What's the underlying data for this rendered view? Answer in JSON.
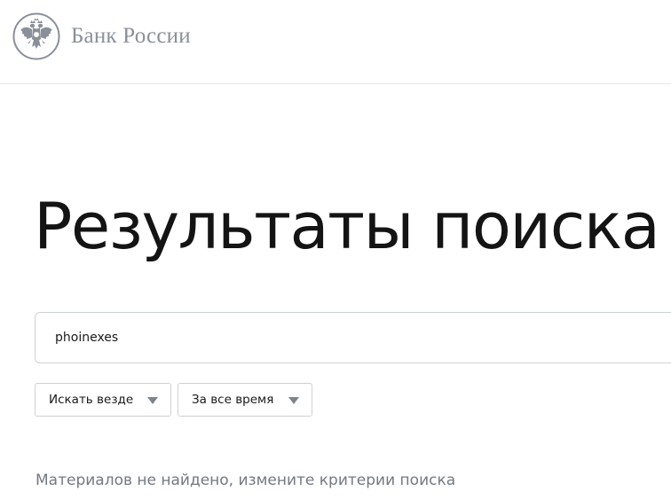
{
  "header": {
    "logo_text": "Банк России",
    "logo_icon": "double-headed-eagle-emblem",
    "brand_color": "#8a9099"
  },
  "main": {
    "title": "Результаты поиска",
    "search": {
      "value": "phoinexes",
      "placeholder": ""
    },
    "filters": [
      {
        "label": "Искать везде",
        "icon": "triangle-down-icon"
      },
      {
        "label": "За все время",
        "icon": "triangle-down-icon"
      }
    ],
    "empty_message": "Материалов не найдено, измените критерии поиска"
  },
  "colors": {
    "title": "#141414",
    "muted_text": "#737982",
    "border": "#cdd1d6",
    "divider": "#e6e8eb"
  }
}
